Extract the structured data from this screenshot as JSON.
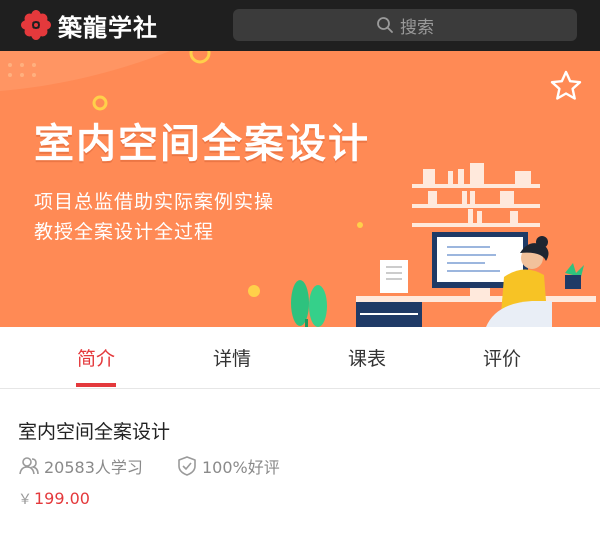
{
  "header": {
    "brand_name": "築龍学社",
    "logo_icon": "red-flower-logo",
    "search": {
      "placeholder": "搜索",
      "icon": "search-icon"
    }
  },
  "banner": {
    "title": "室内空间全案设计",
    "subtitle_line1": "项目总监借助实际案例实操",
    "subtitle_line2": "教授全案设计全过程",
    "favorite_icon": "star-outline-icon",
    "background_color": "#ff8a55"
  },
  "tabs": [
    {
      "label": "简介",
      "active": true
    },
    {
      "label": "详情",
      "active": false
    },
    {
      "label": "课表",
      "active": false
    },
    {
      "label": "评价",
      "active": false
    }
  ],
  "course": {
    "title": "室内空间全案设计",
    "learners": "20583人学习",
    "learners_icon": "users-icon",
    "rating": "100%好评",
    "rating_icon": "thumbs-badge-icon",
    "currency": "￥",
    "price": "199.00"
  },
  "colors": {
    "accent": "#e4393c",
    "topbar": "#1f1f1f"
  }
}
